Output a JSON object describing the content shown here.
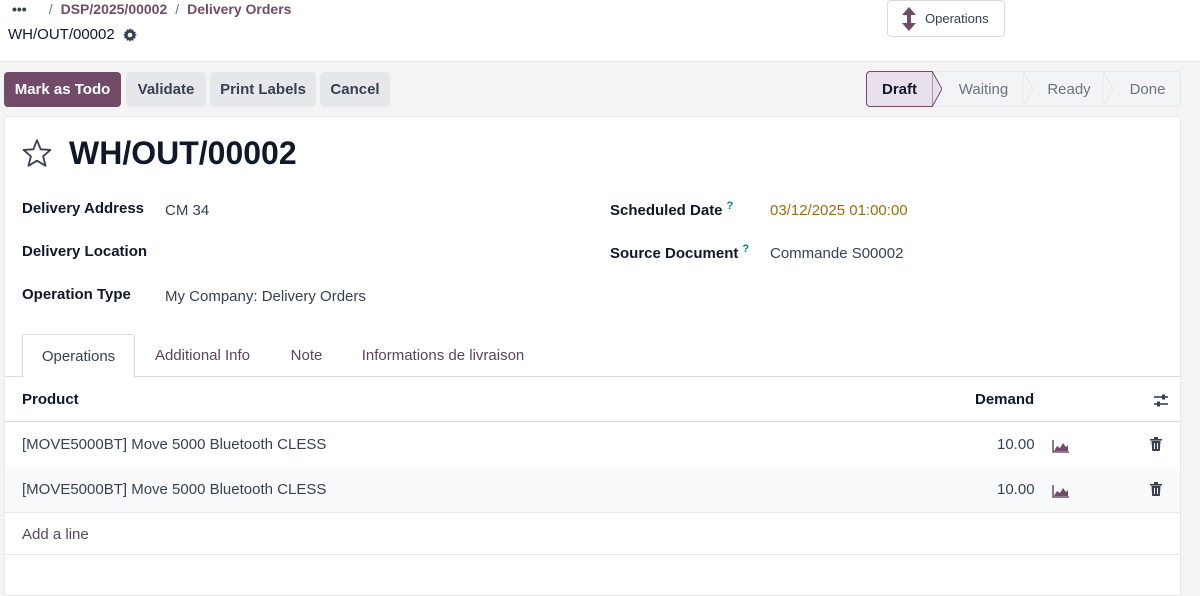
{
  "breadcrumb": {
    "dots": "•••",
    "items": [
      "DSP/2025/00002",
      "Delivery Orders"
    ]
  },
  "record": {
    "name": "WH/OUT/00002"
  },
  "header_button": {
    "label": "Operations"
  },
  "actions": {
    "mark_todo": "Mark as Todo",
    "validate": "Validate",
    "print_labels": "Print Labels",
    "cancel": "Cancel"
  },
  "status": {
    "stages": [
      "Draft",
      "Waiting",
      "Ready",
      "Done"
    ],
    "current": "Draft"
  },
  "form": {
    "title": "WH/OUT/00002",
    "fields": {
      "delivery_address_label": "Delivery Address",
      "delivery_address_value": "CM 34",
      "delivery_location_label": "Delivery Location",
      "operation_type_label": "Operation Type",
      "operation_type_value": "My Company: Delivery Orders",
      "scheduled_date_label": "Scheduled Date",
      "scheduled_date_value": "03/12/2025 01:00:00",
      "source_document_label": "Source Document",
      "source_document_value": "Commande S00002",
      "help_mark": "?"
    }
  },
  "tabs": [
    "Operations",
    "Additional Info",
    "Note",
    "Informations de livraison"
  ],
  "table": {
    "columns": [
      "Product",
      "Demand"
    ],
    "rows": [
      {
        "product": "[MOVE5000BT] Move 5000 Bluetooth CLESS",
        "demand": "10.00"
      },
      {
        "product": "[MOVE5000BT] Move 5000 Bluetooth CLESS",
        "demand": "10.00"
      }
    ],
    "add_line": "Add a line"
  },
  "colors": {
    "primary": "#714b67",
    "date": "#9a6e10",
    "help": "#017e84"
  }
}
